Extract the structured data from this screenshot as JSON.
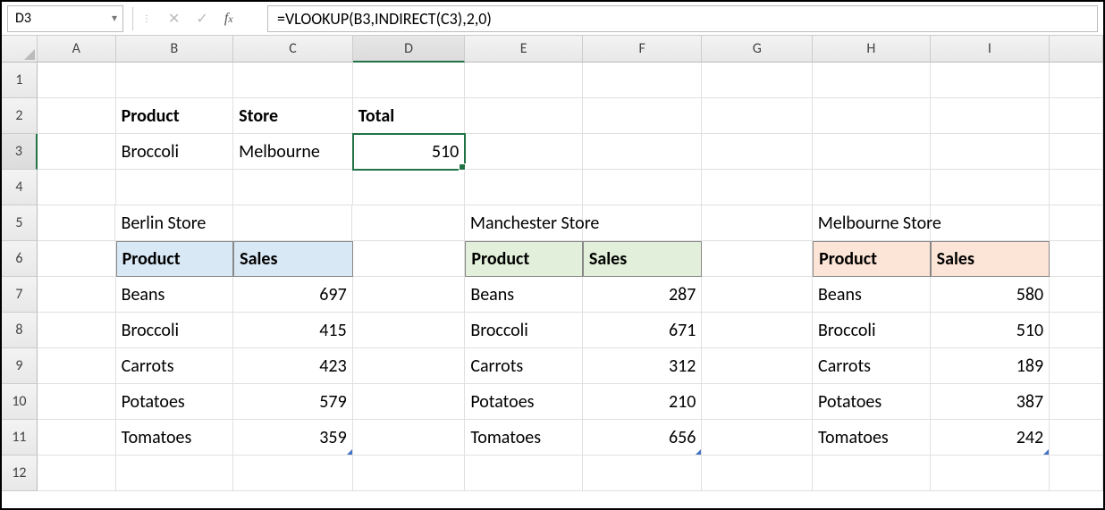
{
  "formula_bar": {
    "cell_ref": "D3",
    "formula": "=VLOOKUP(B3,INDIRECT(C3),2,0)"
  },
  "columns": [
    "A",
    "B",
    "C",
    "D",
    "E",
    "F",
    "G",
    "H",
    "I"
  ],
  "selected_col": "D",
  "selected_row": "3",
  "rows": [
    "1",
    "2",
    "3",
    "4",
    "5",
    "6",
    "7",
    "8",
    "9",
    "10",
    "11",
    "12"
  ],
  "lookup": {
    "h_product": "Product",
    "h_store": "Store",
    "h_total": "Total",
    "product": "Broccoli",
    "store": "Melbourne",
    "total": "510"
  },
  "stores": {
    "berlin": {
      "title": "Berlin Store",
      "h_product": "Product",
      "h_sales": "Sales",
      "rows": [
        {
          "p": "Beans",
          "v": "697"
        },
        {
          "p": "Broccoli",
          "v": "415"
        },
        {
          "p": "Carrots",
          "v": "423"
        },
        {
          "p": "Potatoes",
          "v": "579"
        },
        {
          "p": "Tomatoes",
          "v": "359"
        }
      ]
    },
    "manchester": {
      "title": "Manchester Store",
      "h_product": "Product",
      "h_sales": "Sales",
      "rows": [
        {
          "p": "Beans",
          "v": "287"
        },
        {
          "p": "Broccoli",
          "v": "671"
        },
        {
          "p": "Carrots",
          "v": "312"
        },
        {
          "p": "Potatoes",
          "v": "210"
        },
        {
          "p": "Tomatoes",
          "v": "656"
        }
      ]
    },
    "melbourne": {
      "title": "Melbourne Store",
      "h_product": "Product",
      "h_sales": "Sales",
      "rows": [
        {
          "p": "Beans",
          "v": "580"
        },
        {
          "p": "Broccoli",
          "v": "510"
        },
        {
          "p": "Carrots",
          "v": "189"
        },
        {
          "p": "Potatoes",
          "v": "387"
        },
        {
          "p": "Tomatoes",
          "v": "242"
        }
      ]
    }
  }
}
